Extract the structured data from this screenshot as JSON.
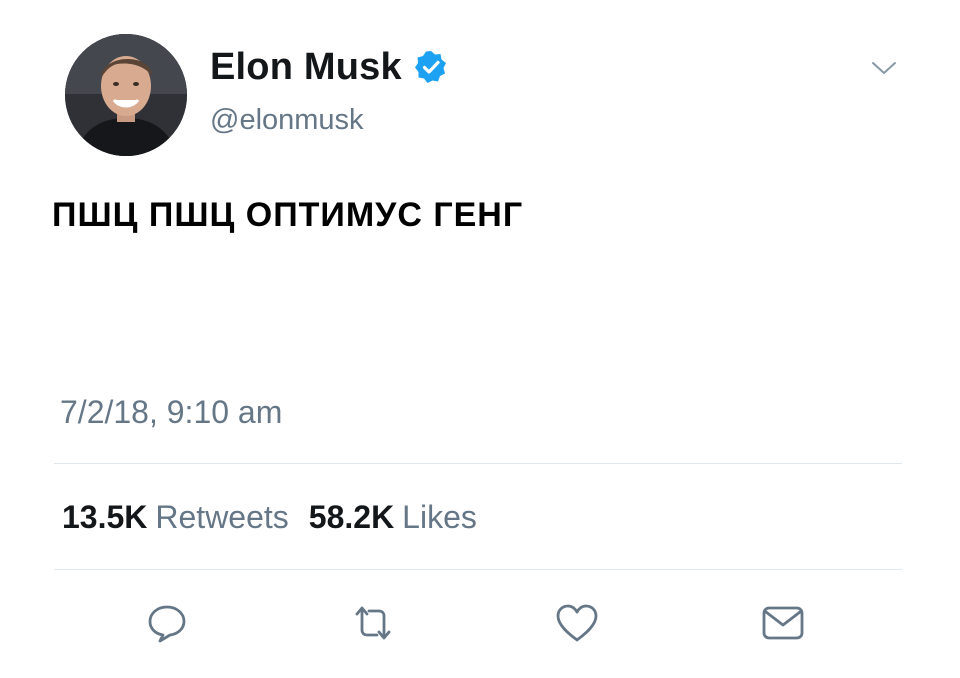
{
  "user": {
    "display_name": "Elon Musk",
    "handle": "@elonmusk",
    "verified": true,
    "avatar_icon": "profile-photo"
  },
  "tweet": {
    "text": "ПШЦ ПШЦ ОПТИМУС ГЕНГ",
    "timestamp": "7/2/18, 9:10 am"
  },
  "stats": {
    "retweets_count": "13.5K",
    "retweets_label": "Retweets",
    "likes_count": "58.2K",
    "likes_label": "Likes"
  },
  "actions": [
    {
      "name": "reply",
      "icon": "reply-icon"
    },
    {
      "name": "retweet",
      "icon": "retweet-icon"
    },
    {
      "name": "like",
      "icon": "heart-icon"
    },
    {
      "name": "direct-message",
      "icon": "envelope-icon"
    }
  ],
  "colors": {
    "text": "#14171a",
    "secondary": "#657786",
    "verified_blue": "#1da1f2",
    "divider": "#e1e8ed"
  }
}
